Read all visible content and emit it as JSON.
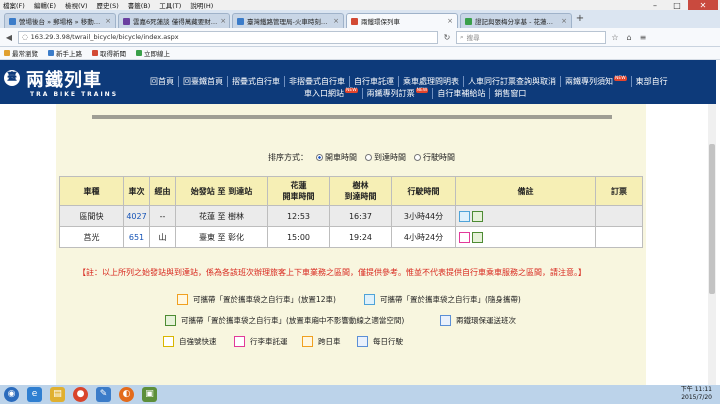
{
  "browser": {
    "menu": [
      "檔案(F)",
      "編輯(E)",
      "檢視(V)",
      "歷史(S)",
      "書籤(B)",
      "工具(T)",
      "說明(H)"
    ],
    "tabs": [
      {
        "title": "營場後台 » 郵場格 » 移動…",
        "active": false
      },
      {
        "title": "雲嘉6死蓮談 僅得萬藏要財…",
        "active": false
      },
      {
        "title": "臺灣鐵路管理局-火車時刻…",
        "active": false
      },
      {
        "title": "兩鐵環保列車",
        "active": true
      },
      {
        "title": "證記與張梅分享基 - 花蓮…",
        "active": false
      }
    ],
    "url": "163.29.3.98/twrail_bicycle/bicycle/index.aspx",
    "search_placeholder": "搜尋",
    "bookmarks": [
      "最常瀏覽",
      "新手上路",
      "取得新聞",
      "立即線上"
    ]
  },
  "site": {
    "logo_symbol": "臺",
    "logo_title": "兩鐵列車",
    "logo_sub": "TRA  BIKE  TRAINS",
    "nav_row1": [
      {
        "label": "回首頁",
        "new": false
      },
      {
        "label": "回臺鐵首頁",
        "new": false
      },
      {
        "label": "摺疊式自行車",
        "new": false
      },
      {
        "label": "非摺疊式自行車",
        "new": false
      },
      {
        "label": "自行車託運",
        "new": false
      },
      {
        "label": "乘車處理問明表",
        "new": false
      },
      {
        "label": "人車同行訂票查詢與取消",
        "new": false
      },
      {
        "label": "兩鐵專列須知",
        "new": true
      },
      {
        "label": "東部自行",
        "new": false
      }
    ],
    "nav_row2": [
      {
        "label": "車入口網站",
        "new": true
      },
      {
        "label": "兩鐵專列訂票",
        "new": true
      },
      {
        "label": "自行車補給站",
        "new": false
      },
      {
        "label": "銷售窗口",
        "new": false
      }
    ],
    "new_badge": "NEW"
  },
  "sort": {
    "label": "排序方式：",
    "options": [
      {
        "label": "開車時間",
        "selected": true
      },
      {
        "label": "到達時間",
        "selected": false
      },
      {
        "label": "行駛時間",
        "selected": false
      }
    ]
  },
  "table": {
    "headers": [
      "車種",
      "車次",
      "經由",
      "始發站 至 到達站",
      "花蓮\n開車時間",
      "樹林\n到達時間",
      "行駛時間",
      "備註",
      "訂票"
    ],
    "rows": [
      {
        "type": "區間快",
        "no": "4027",
        "via": "--",
        "route": "花蓮 至 樹林",
        "dep": "12:53",
        "arr": "16:37",
        "dur": "3小時44分",
        "icons": [
          "bike-blue",
          "bike-green"
        ],
        "book": ""
      },
      {
        "type": "莒光",
        "no": "651",
        "via": "山",
        "route": "臺東 至 彰化",
        "dep": "15:00",
        "arr": "19:24",
        "dur": "4小時24分",
        "icons": [
          "pink",
          "bike-green"
        ],
        "book": ""
      }
    ]
  },
  "note": "【註：以上所列之始發站與到達站，係為各該班次辦理旅客上下車業務之區間，僅提供參考。惟並不代表提供自行車乘車服務之區間，請注意。】",
  "legend": [
    {
      "icon": "orange",
      "text": "可攜帶「置於攜車袋之自行車」(放置12車)"
    },
    {
      "icon": "bike-blue",
      "text": "可攜帶「置於攜車袋之自行車」(隨身攜帶)"
    },
    {
      "icon": "bike-green",
      "text": "可攜帶「置於攜車袋之自行車」(放置車廂中不影響動線之適當空間)"
    },
    {
      "icon": "lblue",
      "text": "兩鐵環保運送班次"
    },
    {
      "icon": "yellow",
      "text": "自強號快速"
    },
    {
      "icon": "pink",
      "text": "行李車託運"
    },
    {
      "icon": "orange",
      "text": "跨日車"
    },
    {
      "icon": "lblue",
      "text": "每日行駛"
    }
  ],
  "clock": {
    "time": "下午 11:11",
    "date": "2015/7/20"
  }
}
